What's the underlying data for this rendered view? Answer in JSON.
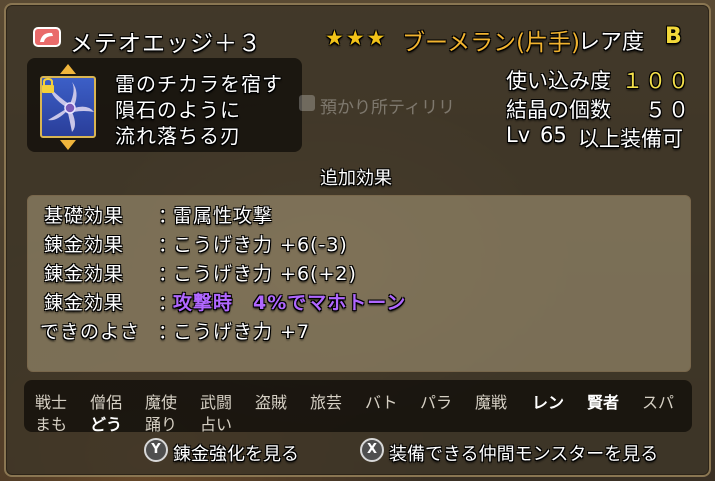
{
  "item": {
    "name": "メテオエッジ＋３",
    "stars": "★★★",
    "weapon_type": "ブーメラン(片手)",
    "rarity_label": "レア度",
    "rarity_value": "B"
  },
  "description": [
    "雷のチカラを宿す",
    "隕石のように",
    "流れ落ちる刃"
  ],
  "owner": "預かり所ティリリ",
  "stats": {
    "usage_label": "使い込み度",
    "usage_value": "１００",
    "crystals_label": "結晶の個数",
    "crystals_value": "５０",
    "level_prefix": "Lv",
    "level_value": "65",
    "level_suffix": "以上装備可"
  },
  "effects": {
    "title": "追加効果",
    "rows": [
      {
        "label": "基礎効果",
        "value": "雷属性攻撃"
      },
      {
        "label": "錬金効果",
        "value": "こうげき力 +6(-3)"
      },
      {
        "label": "錬金効果",
        "value": "こうげき力 +6(+2)"
      },
      {
        "label": "錬金効果",
        "value": "攻撃時　4%でマホトーン"
      },
      {
        "label": "できのよさ",
        "value": "こうげき力 +7"
      }
    ],
    "colon": "："
  },
  "jobs": {
    "row1": [
      "戦士",
      "僧侶",
      "魔使",
      "武闘",
      "盗賊",
      "旅芸",
      "バト",
      "パラ",
      "魔戦",
      "レン",
      "賢者",
      "スパ"
    ],
    "row2": [
      "まも",
      "どう",
      "踊り",
      "占い"
    ]
  },
  "buttons": {
    "y_key": "Y",
    "y_label": "錬金強化を見る",
    "x_key": "X",
    "x_label": "装備できる仲間モンスターを見る"
  },
  "colors": {
    "stars": "#f2c318",
    "weapon_type": "#f2b430",
    "highlight_value": "#f4e04a",
    "special_effect": "#b067ff"
  },
  "icons": {
    "category": "boomerang-category-icon",
    "item": "star-blade-boomerang-icon",
    "lock": "lock-icon"
  }
}
